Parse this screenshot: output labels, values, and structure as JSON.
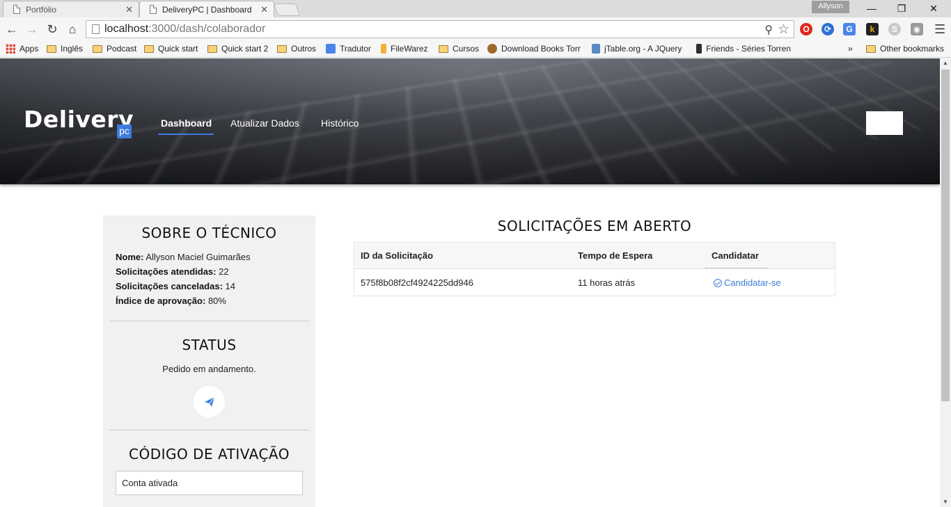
{
  "browser": {
    "tabs": [
      {
        "title": "Portfólio"
      },
      {
        "title": "DeliveryPC | Dashboard"
      }
    ],
    "profile_name": "Allyson",
    "url": {
      "host": "localhost",
      "path": ":3000/dash/colaborador"
    },
    "bookmarks": [
      {
        "label": "Apps",
        "icon": "apps-grid-icon"
      },
      {
        "label": "Inglês",
        "icon": "folder-icon"
      },
      {
        "label": "Podcast",
        "icon": "folder-icon"
      },
      {
        "label": "Quick start",
        "icon": "folder-icon"
      },
      {
        "label": "Quick start 2",
        "icon": "folder-icon"
      },
      {
        "label": "Outros",
        "icon": "folder-icon"
      },
      {
        "label": "Tradutor",
        "icon": "translate-icon"
      },
      {
        "label": "FileWarez",
        "icon": "filewarez-icon"
      },
      {
        "label": "Cursos",
        "icon": "folder-icon"
      },
      {
        "label": "Download Books Torr",
        "icon": "books-icon"
      },
      {
        "label": "jTable.org - A JQuery",
        "icon": "jtable-icon"
      },
      {
        "label": "Friends - Séries Torren",
        "icon": "friends-icon"
      }
    ],
    "bookmarks_overflow": "»",
    "other_bookmarks": "Other bookmarks"
  },
  "site": {
    "logo_text": "Delivery",
    "logo_badge": "pc",
    "nav": [
      {
        "label": "Dashboard",
        "active": true
      },
      {
        "label": "Atualizar Dados",
        "active": false
      },
      {
        "label": "Histórico",
        "active": false
      }
    ]
  },
  "about": {
    "heading": "SOBRE O TÉCNICO",
    "fields": [
      {
        "label": "Nome:",
        "value": "Allyson Maciel Guimarães"
      },
      {
        "label": "Solicitações atendidas:",
        "value": "22"
      },
      {
        "label": "Solicitações canceladas:",
        "value": "14"
      },
      {
        "label": "Índice de aprovação:",
        "value": "80%"
      }
    ]
  },
  "status": {
    "heading": "STATUS",
    "text": "Pedido em andamento."
  },
  "activation": {
    "heading": "CÓDIGO DE ATIVAÇÃO",
    "value": "Conta ativada"
  },
  "requests": {
    "title": "SOLICITAÇÕES EM ABERTO",
    "columns": [
      "ID da Solicitação",
      "Tempo de Espera",
      "Candidatar"
    ],
    "rows": [
      {
        "id": "575f8b08f2cf4924225dd946",
        "wait": "11 horas atrás",
        "action": "Candidatar-se"
      }
    ]
  },
  "colors": {
    "accent": "#3d7bdc",
    "sidebar_bg": "#f1f1f1"
  }
}
